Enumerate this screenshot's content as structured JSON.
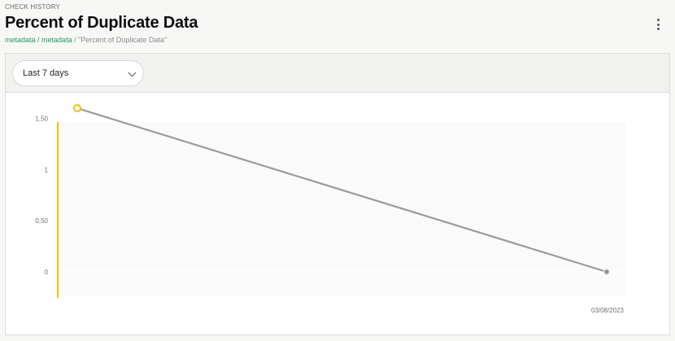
{
  "header": {
    "eyebrow": "CHECK HISTORY",
    "title": "Percent of Duplicate Data",
    "breadcrumb": {
      "link1": "metadata",
      "sep1": " / ",
      "link2": "metadata",
      "sep2": " / ",
      "current": "\"Percent of Duplicate Data\""
    }
  },
  "toolbar": {
    "range_select": {
      "value": "Last 7 days"
    }
  },
  "chart_data": {
    "type": "line",
    "title": "",
    "xlabel": "",
    "ylabel": "",
    "ylim": [
      0,
      1.6
    ],
    "y_ticks": [
      {
        "value": 0,
        "label": "0"
      },
      {
        "value": 0.5,
        "label": "0,50"
      },
      {
        "value": 1,
        "label": "1"
      },
      {
        "value": 1.5,
        "label": "1,50"
      }
    ],
    "x_tick_label": "03/08/2023",
    "grid": false,
    "points": [
      {
        "index": 0,
        "y": 1.6,
        "marker": "hollow-yellow"
      },
      {
        "index": 1,
        "y": 0,
        "marker": "filled-gray"
      }
    ],
    "colors": {
      "line": "#9a9a9a",
      "highlight": "#f2c200",
      "plot_bg": "#fafafa",
      "point_end": "#8f8f8f"
    }
  }
}
